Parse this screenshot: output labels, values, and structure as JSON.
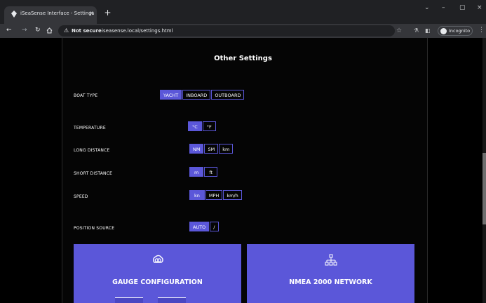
{
  "browser": {
    "tab_title": "iSeaSense Interface - Settings",
    "tab_close": "×",
    "new_tab": "+",
    "window_minimize": "–",
    "window_maximize": "▢",
    "window_close": "×",
    "tabs_dropdown": "⌄",
    "not_secure": "Not secure",
    "url": "iseasense.local/settings.html",
    "profile_label": "Incognito"
  },
  "page": {
    "section_title": "Other Settings",
    "settings": [
      {
        "label": "BOAT TYPE",
        "options": [
          "YACHT",
          "INBOARD",
          "OUTBOARD"
        ],
        "selected": 0
      },
      {
        "label": "TEMPERATURE",
        "options": [
          "°C",
          "°F"
        ],
        "selected": 0
      },
      {
        "label": "LONG DISTANCE",
        "options": [
          "NM",
          "SM",
          "km"
        ],
        "selected": 0
      },
      {
        "label": "SHORT DISTANCE",
        "options": [
          "m",
          "ft"
        ],
        "selected": 0
      },
      {
        "label": "SPEED",
        "options": [
          "kn",
          "MPH",
          "km/h"
        ],
        "selected": 0
      },
      {
        "label": "POSITION SOURCE",
        "options": [
          "AUTO",
          "/"
        ],
        "selected": 0
      }
    ],
    "cards": [
      {
        "title": "GAUGE CONFIGURATION",
        "icon": "gauge-config-icon"
      },
      {
        "title": "NMEA 2000 NETWORK",
        "icon": "network-icon"
      }
    ]
  },
  "colors": {
    "accent": "#5b57d9",
    "background": "#000000"
  }
}
